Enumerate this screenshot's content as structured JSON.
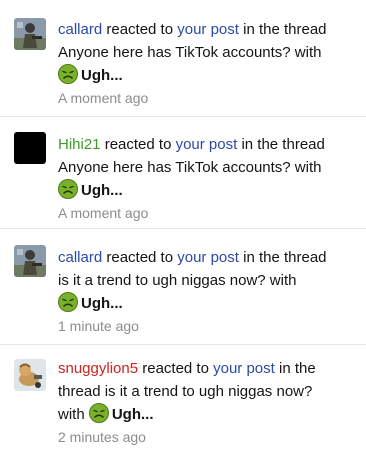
{
  "notifications": [
    {
      "user": "callard",
      "user_color": "#2b4aa5",
      "avatar": "callard-avatar",
      "action": " reacted to ",
      "link": "your post",
      "after_link": " in the thread",
      "line2": "Anyone here has TikTok accounts? with",
      "line3_prefix": "",
      "reaction": "Ugh...",
      "reaction_icon": "sick-face-icon",
      "time": "A moment ago"
    },
    {
      "user": "Hihi21",
      "user_color": "#3d9c29",
      "avatar": "hihi21-avatar",
      "action": " reacted to ",
      "link": "your post",
      "after_link": " in the thread",
      "line2": "Anyone here has TikTok accounts? with",
      "line3_prefix": "",
      "reaction": "Ugh...",
      "reaction_icon": "sick-face-icon",
      "time": "A moment ago"
    },
    {
      "user": "callard",
      "user_color": "#2b4aa5",
      "avatar": "callard-avatar",
      "action": " reacted to ",
      "link": "your post",
      "after_link": " in the thread",
      "line2": "is it a trend to ugh niggas now? with",
      "line3_prefix": "",
      "reaction": "Ugh...",
      "reaction_icon": "sick-face-icon",
      "time": "1 minute ago"
    },
    {
      "user": "snuggylion5",
      "user_color": "#d02020",
      "avatar": "snuggylion5-avatar",
      "action": " reacted to ",
      "link": "your post",
      "after_link": " in the",
      "line2": "thread is it a trend to ugh niggas now?",
      "line3_prefix": "with ",
      "reaction": "Ugh...",
      "reaction_icon": "sick-face-icon",
      "time": "2 minutes ago"
    }
  ]
}
